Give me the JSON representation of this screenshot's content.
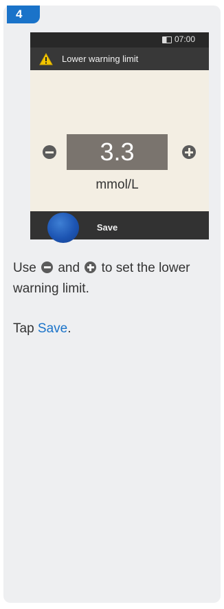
{
  "step": {
    "number": "4"
  },
  "device": {
    "status": {
      "time": "07:00"
    },
    "title": "Lower warning limit",
    "value": "3.3",
    "unit": "mmol/L",
    "save_label": "Save"
  },
  "instructions": {
    "line1_prefix": "Use",
    "line1_and": "and",
    "line1_suffix": "to set the lower",
    "line2": "warning limit.",
    "tap_prefix": "Tap",
    "tap_link": "Save",
    "tap_suffix": "."
  },
  "colors": {
    "accent": "#1a73c9",
    "panel": "#eeeff1",
    "screen_bg": "#f3eee3",
    "value_box": "#7a746e"
  },
  "icons": [
    "battery-icon",
    "warning-icon",
    "minus-icon",
    "plus-icon"
  ]
}
